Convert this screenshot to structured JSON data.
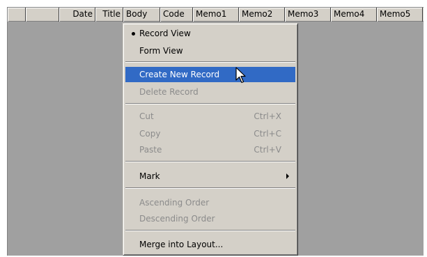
{
  "table": {
    "columns": [
      {
        "label": ""
      },
      {
        "label": ""
      },
      {
        "label": "Date"
      },
      {
        "label": "Title"
      },
      {
        "label": "Body"
      },
      {
        "label": "Code"
      },
      {
        "label": "Memo1"
      },
      {
        "label": "Memo2"
      },
      {
        "label": "Memo3"
      },
      {
        "label": "Memo4"
      },
      {
        "label": "Memo5"
      }
    ]
  },
  "context_menu": {
    "items": [
      {
        "label": "Record View",
        "shortcut": "",
        "enabled": true,
        "checked": true
      },
      {
        "label": "Form View",
        "shortcut": "",
        "enabled": true
      },
      {
        "label": "Create New Record",
        "shortcut": "",
        "enabled": true,
        "highlighted": true
      },
      {
        "label": "Delete Record",
        "shortcut": "",
        "enabled": false
      },
      {
        "label": "Cut",
        "shortcut": "Ctrl+X",
        "enabled": false
      },
      {
        "label": "Copy",
        "shortcut": "Ctrl+C",
        "enabled": false
      },
      {
        "label": "Paste",
        "shortcut": "Ctrl+V",
        "enabled": false
      },
      {
        "label": "Mark",
        "shortcut": "",
        "enabled": true,
        "submenu": true
      },
      {
        "label": "Ascending Order",
        "shortcut": "",
        "enabled": false
      },
      {
        "label": "Descending Order",
        "shortcut": "",
        "enabled": false
      },
      {
        "label": "Merge into Layout...",
        "shortcut": "",
        "enabled": true
      }
    ]
  },
  "colors": {
    "highlight": "#316ac5",
    "menu_background": "#d4d0c8",
    "disabled_text": "#8b8b8b",
    "workspace": "#a0a0a0"
  },
  "icons": {
    "cursor": "arrow-pointer-icon",
    "submenu": "submenu-arrow-icon",
    "checked": "radio-bullet-icon"
  }
}
